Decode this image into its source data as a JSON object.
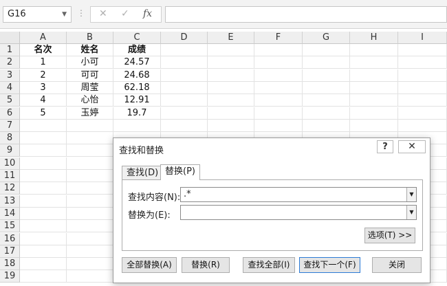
{
  "formula_bar": {
    "name_box": "G16",
    "cancel_icon": "✕",
    "enter_icon": "✓",
    "fx_icon": "fx",
    "formula": ""
  },
  "columns": [
    "A",
    "B",
    "C",
    "D",
    "E",
    "F",
    "G",
    "H",
    "I"
  ],
  "rows": [
    "1",
    "2",
    "3",
    "4",
    "5",
    "6",
    "7",
    "8",
    "9",
    "10",
    "11",
    "12",
    "13",
    "14",
    "15",
    "16",
    "17",
    "18",
    "19"
  ],
  "sheet": {
    "headers": [
      "名次",
      "姓名",
      "成绩"
    ],
    "records": [
      [
        "1",
        "小可",
        "24.57"
      ],
      [
        "2",
        "可可",
        "24.68"
      ],
      [
        "3",
        "周莹",
        "62.18"
      ],
      [
        "4",
        "心怡",
        "12.91"
      ],
      [
        "5",
        "玉婷",
        "19.7"
      ]
    ]
  },
  "dialog": {
    "title": "查找和替换",
    "help_icon": "?",
    "close_icon": "✕",
    "tabs": [
      "查找(D)",
      "替换(P)"
    ],
    "active_tab": "替换(P)",
    "find_label": "查找内容(N):",
    "find_value": ".*",
    "replace_label": "替换为(E):",
    "replace_value": "",
    "options_button": "选项(T) >>",
    "buttons": {
      "replace_all": "全部替换(A)",
      "replace": "替换(R)",
      "find_all": "查找全部(I)",
      "find_next": "查找下一个(F)",
      "close": "关闭"
    }
  }
}
